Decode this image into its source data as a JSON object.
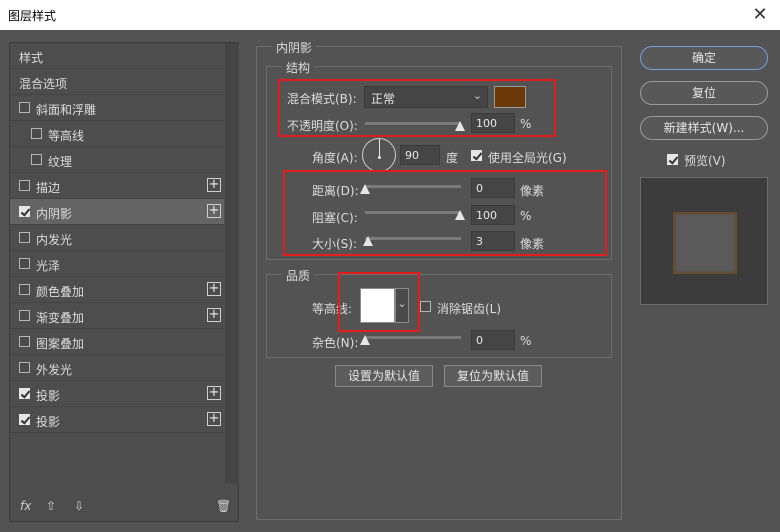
{
  "window": {
    "title": "图层样式",
    "close": "✕"
  },
  "left_panel": {
    "items": [
      {
        "label": "样式",
        "checkbox": null,
        "plus": false,
        "indent": 0,
        "selected": false
      },
      {
        "label": "混合选项",
        "checkbox": null,
        "plus": false,
        "indent": 0,
        "selected": false
      },
      {
        "label": "斜面和浮雕",
        "checkbox": false,
        "plus": false,
        "indent": 0,
        "selected": false
      },
      {
        "label": "等高线",
        "checkbox": false,
        "plus": false,
        "indent": 1,
        "selected": false
      },
      {
        "label": "纹理",
        "checkbox": false,
        "plus": false,
        "indent": 1,
        "selected": false
      },
      {
        "label": "描边",
        "checkbox": false,
        "plus": true,
        "indent": 0,
        "selected": false
      },
      {
        "label": "内阴影",
        "checkbox": true,
        "plus": true,
        "indent": 0,
        "selected": true
      },
      {
        "label": "内发光",
        "checkbox": false,
        "plus": false,
        "indent": 0,
        "selected": false
      },
      {
        "label": "光泽",
        "checkbox": false,
        "plus": false,
        "indent": 0,
        "selected": false
      },
      {
        "label": "颜色叠加",
        "checkbox": false,
        "plus": true,
        "indent": 0,
        "selected": false
      },
      {
        "label": "渐变叠加",
        "checkbox": false,
        "plus": true,
        "indent": 0,
        "selected": false
      },
      {
        "label": "图案叠加",
        "checkbox": false,
        "plus": false,
        "indent": 0,
        "selected": false
      },
      {
        "label": "外发光",
        "checkbox": false,
        "plus": false,
        "indent": 0,
        "selected": false
      },
      {
        "label": "投影",
        "checkbox": true,
        "plus": true,
        "indent": 0,
        "selected": false
      },
      {
        "label": "投影",
        "checkbox": true,
        "plus": true,
        "indent": 0,
        "selected": false
      }
    ],
    "footer": {
      "fx": "fx",
      "up": "⇧",
      "down": "⇩",
      "trash": "🗑"
    }
  },
  "inner_shadow": {
    "section_title": "内阴影",
    "structure": {
      "title": "结构",
      "blend_mode_label": "混合模式(B):",
      "blend_mode_value": "正常",
      "shadow_color": "#6b3a08",
      "opacity_label": "不透明度(O):",
      "opacity_value": "100",
      "opacity_unit": "%",
      "angle_label": "角度(A):",
      "angle_value": "90",
      "angle_unit": "度",
      "global_light_label": "使用全局光(G)",
      "global_light_checked": true,
      "distance_label": "距离(D):",
      "distance_value": "0",
      "distance_unit": "像素",
      "choke_label": "阻塞(C):",
      "choke_value": "100",
      "choke_unit": "%",
      "size_label": "大小(S):",
      "size_value": "3",
      "size_unit": "像素"
    },
    "quality": {
      "title": "品质",
      "contour_label": "等高线:",
      "anti_alias_label": "消除锯齿(L)",
      "anti_alias_checked": false,
      "noise_label": "杂色(N):",
      "noise_value": "0",
      "noise_unit": "%"
    },
    "set_default_button": "设置为默认值",
    "reset_default_button": "复位为默认值"
  },
  "right_panel": {
    "ok_button": "确定",
    "reset_button": "复位",
    "new_style_button": "新建样式(W)...",
    "preview_label": "预览(V)",
    "preview_checked": true,
    "accent_color": "#6ea3e0",
    "annotation_color": "#e51c1c"
  }
}
